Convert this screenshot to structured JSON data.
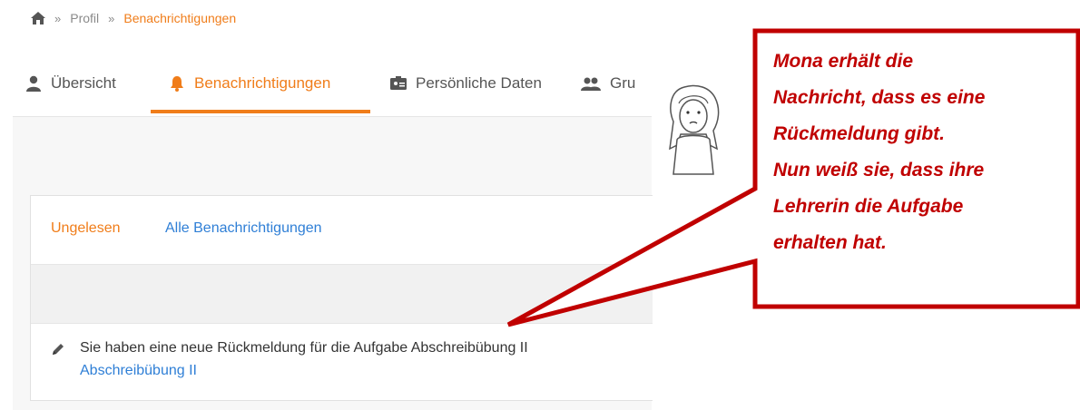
{
  "breadcrumb": {
    "home_icon": "home-icon",
    "separator": "»",
    "items": [
      "Profil",
      "Benachrichtigungen"
    ]
  },
  "tabs": [
    {
      "label": "Übersicht",
      "icon": "user-icon"
    },
    {
      "label": "Benachrichtigungen",
      "icon": "bell-icon",
      "active": true
    },
    {
      "label": "Persönliche Daten",
      "icon": "id-card-icon"
    },
    {
      "label": "Gru",
      "icon": "group-icon"
    }
  ],
  "filters": {
    "unread": "Ungelesen",
    "all": "Alle Benachrichtigungen"
  },
  "notification": {
    "icon": "pencil-icon",
    "text": "Sie haben eine neue Rückmeldung für die Aufgabe Abschreibübung II",
    "link": "Abschreibübung II"
  },
  "callout": {
    "lines": [
      "Mona erhält die",
      "Nachricht, dass es eine",
      "Rückmeldung gibt.",
      "Nun weiß sie, dass ihre",
      "Lehrerin die Aufgabe",
      "erhalten hat."
    ]
  },
  "colors": {
    "accent": "#f07d1a",
    "link": "#2f7fd6",
    "callout_border": "#c00000",
    "callout_text": "#c00000"
  }
}
